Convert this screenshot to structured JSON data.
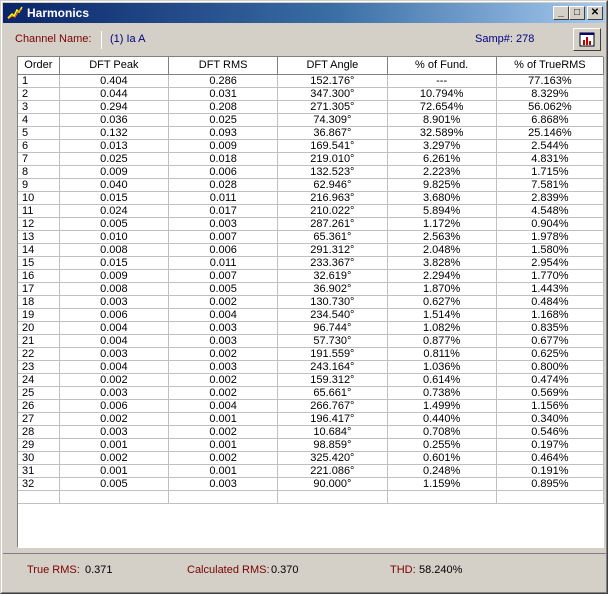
{
  "window": {
    "title": "Harmonics",
    "min_glyph": "_",
    "max_glyph": "□",
    "close_glyph": "✕"
  },
  "header": {
    "channel_label": "Channel Name:",
    "channel_value": "(1)  Ia A",
    "samp": "Samp#: 278"
  },
  "table": {
    "columns": [
      "Order",
      "DFT Peak",
      "DFT RMS",
      "DFT Angle",
      "% of Fund.",
      "% of TrueRMS"
    ],
    "rows": [
      [
        "1",
        "0.404",
        "0.286",
        "152.176°",
        "---",
        "77.163%"
      ],
      [
        "2",
        "0.044",
        "0.031",
        "347.300°",
        "10.794%",
        "8.329%"
      ],
      [
        "3",
        "0.294",
        "0.208",
        "271.305°",
        "72.654%",
        "56.062%"
      ],
      [
        "4",
        "0.036",
        "0.025",
        "74.309°",
        "8.901%",
        "6.868%"
      ],
      [
        "5",
        "0.132",
        "0.093",
        "36.867°",
        "32.589%",
        "25.146%"
      ],
      [
        "6",
        "0.013",
        "0.009",
        "169.541°",
        "3.297%",
        "2.544%"
      ],
      [
        "7",
        "0.025",
        "0.018",
        "219.010°",
        "6.261%",
        "4.831%"
      ],
      [
        "8",
        "0.009",
        "0.006",
        "132.523°",
        "2.223%",
        "1.715%"
      ],
      [
        "9",
        "0.040",
        "0.028",
        "62.946°",
        "9.825%",
        "7.581%"
      ],
      [
        "10",
        "0.015",
        "0.011",
        "216.963°",
        "3.680%",
        "2.839%"
      ],
      [
        "11",
        "0.024",
        "0.017",
        "210.022°",
        "5.894%",
        "4.548%"
      ],
      [
        "12",
        "0.005",
        "0.003",
        "287.261°",
        "1.172%",
        "0.904%"
      ],
      [
        "13",
        "0.010",
        "0.007",
        "65.361°",
        "2.563%",
        "1.978%"
      ],
      [
        "14",
        "0.008",
        "0.006",
        "291.312°",
        "2.048%",
        "1.580%"
      ],
      [
        "15",
        "0.015",
        "0.011",
        "233.367°",
        "3.828%",
        "2.954%"
      ],
      [
        "16",
        "0.009",
        "0.007",
        "32.619°",
        "2.294%",
        "1.770%"
      ],
      [
        "17",
        "0.008",
        "0.005",
        "36.902°",
        "1.870%",
        "1.443%"
      ],
      [
        "18",
        "0.003",
        "0.002",
        "130.730°",
        "0.627%",
        "0.484%"
      ],
      [
        "19",
        "0.006",
        "0.004",
        "234.540°",
        "1.514%",
        "1.168%"
      ],
      [
        "20",
        "0.004",
        "0.003",
        "96.744°",
        "1.082%",
        "0.835%"
      ],
      [
        "21",
        "0.004",
        "0.003",
        "57.730°",
        "0.877%",
        "0.677%"
      ],
      [
        "22",
        "0.003",
        "0.002",
        "191.559°",
        "0.811%",
        "0.625%"
      ],
      [
        "23",
        "0.004",
        "0.003",
        "243.164°",
        "1.036%",
        "0.800%"
      ],
      [
        "24",
        "0.002",
        "0.002",
        "159.312°",
        "0.614%",
        "0.474%"
      ],
      [
        "25",
        "0.003",
        "0.002",
        "65.661°",
        "0.738%",
        "0.569%"
      ],
      [
        "26",
        "0.006",
        "0.004",
        "266.767°",
        "1.499%",
        "1.156%"
      ],
      [
        "27",
        "0.002",
        "0.001",
        "196.417°",
        "0.440%",
        "0.340%"
      ],
      [
        "28",
        "0.003",
        "0.002",
        "10.684°",
        "0.708%",
        "0.546%"
      ],
      [
        "29",
        "0.001",
        "0.001",
        "98.859°",
        "0.255%",
        "0.197%"
      ],
      [
        "30",
        "0.002",
        "0.002",
        "325.420°",
        "0.601%",
        "0.464%"
      ],
      [
        "31",
        "0.001",
        "0.001",
        "221.086°",
        "0.248%",
        "0.191%"
      ],
      [
        "32",
        "0.005",
        "0.003",
        "90.000°",
        "1.159%",
        "0.895%"
      ]
    ]
  },
  "footer": {
    "true_rms_label": "True RMS:",
    "true_rms_value": "0.371",
    "calc_rms_label": "Calculated RMS:",
    "calc_rms_value": "0.370",
    "thd_label": "THD:",
    "thd_value": "58.240%"
  }
}
